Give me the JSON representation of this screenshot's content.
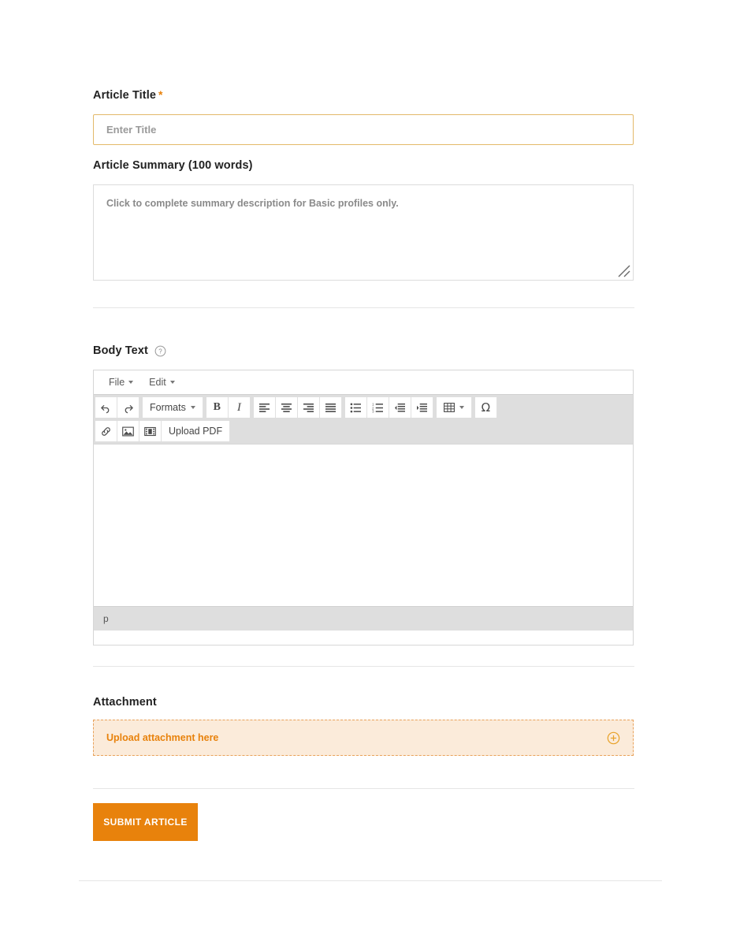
{
  "form": {
    "title_field": {
      "label": "Article Title",
      "required_marker": "*",
      "placeholder": "Enter Title",
      "value": ""
    },
    "summary_field": {
      "label": "Article Summary (100 words)",
      "placeholder": "Click to complete summary description for Basic profiles only.",
      "value": ""
    },
    "body_field": {
      "label": "Body Text",
      "help_icon": "question-circle-icon",
      "status_bar": "p",
      "content": "",
      "menubar": [
        {
          "label": "File"
        },
        {
          "label": "Edit"
        }
      ],
      "toolbar_row_1": [
        {
          "icon": "undo-icon",
          "glyph": "↶"
        },
        {
          "icon": "redo-icon",
          "glyph": "↷"
        },
        {
          "icon": "formats-dropdown",
          "label": "Formats"
        },
        {
          "icon": "bold-icon",
          "glyph": "B"
        },
        {
          "icon": "italic-icon",
          "glyph": "I"
        },
        {
          "icon": "align-left-icon",
          "glyph": "align-left"
        },
        {
          "icon": "align-center-icon",
          "glyph": "align-center"
        },
        {
          "icon": "align-right-icon",
          "glyph": "align-right"
        },
        {
          "icon": "align-justify-icon",
          "glyph": "align-justify"
        },
        {
          "icon": "bullet-list-icon",
          "glyph": "bullets"
        },
        {
          "icon": "numbered-list-icon",
          "glyph": "numbers"
        },
        {
          "icon": "outdent-icon",
          "glyph": "outdent"
        },
        {
          "icon": "indent-icon",
          "glyph": "indent"
        },
        {
          "icon": "table-icon",
          "glyph": "table"
        },
        {
          "icon": "special-char-icon",
          "glyph": "Ω"
        }
      ],
      "toolbar_row_2": [
        {
          "icon": "link-icon",
          "glyph": "link"
        },
        {
          "icon": "image-icon",
          "glyph": "image"
        },
        {
          "icon": "media-icon",
          "glyph": "media"
        },
        {
          "icon": "upload-pdf-button",
          "label": "Upload PDF"
        }
      ]
    },
    "attachment_field": {
      "label": "Attachment",
      "dropzone_text": "Upload attachment here",
      "add_icon": "plus-circle-icon"
    },
    "submit_button": {
      "label": "SUBMIT ARTICLE"
    }
  },
  "colors": {
    "accent_orange": "#E8820C",
    "dropzone_background": "#FBEBDA",
    "dropzone_border": "#E8A15A",
    "title_input_border": "#E3B969",
    "toolbar_background": "#DEDEDE"
  }
}
